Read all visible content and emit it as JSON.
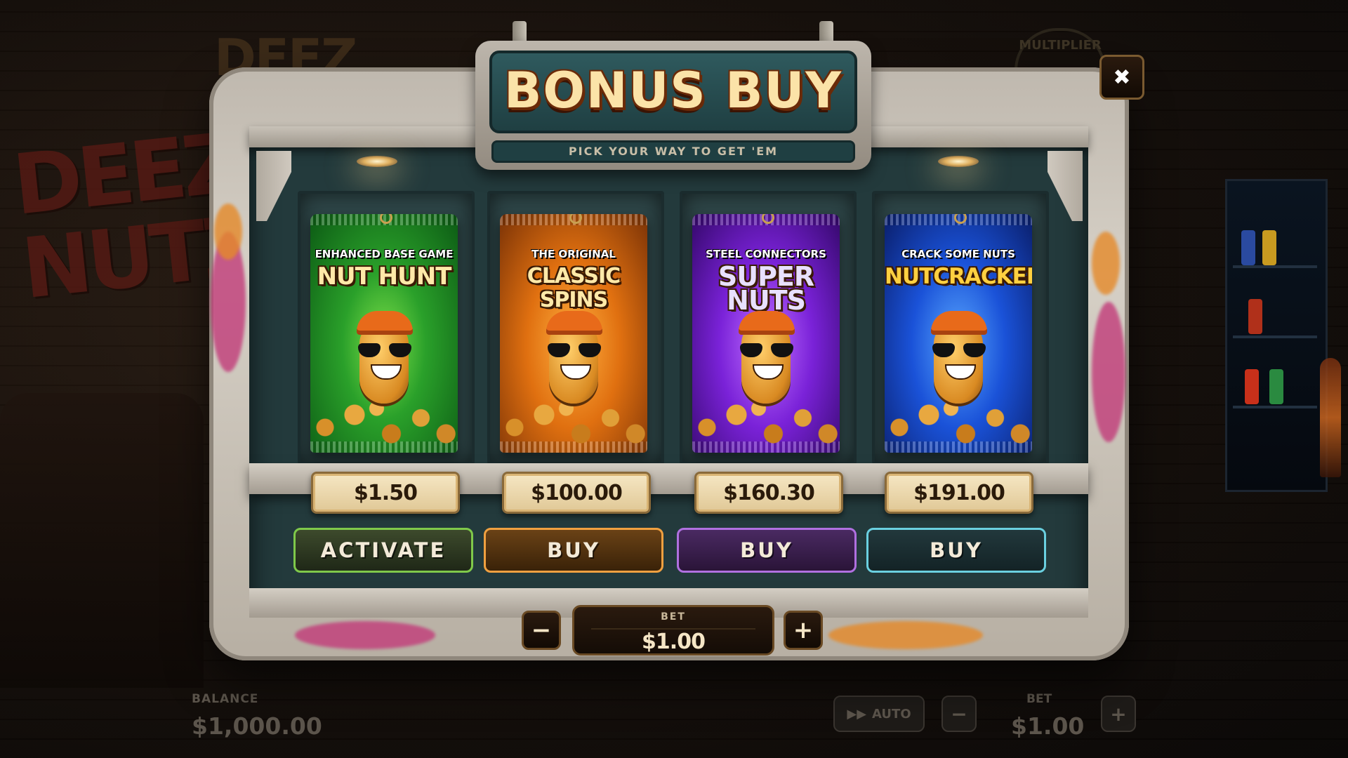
{
  "background": {
    "logo_text": "DEEZ",
    "graffiti_text": "DEEZ NUTZ",
    "multiplier_badge": "MULTIPLIER"
  },
  "hud": {
    "balance_label": "BALANCE",
    "balance_value": "$1,000.00",
    "auto_label": "AUTO",
    "bet_label": "BET",
    "bet_value": "$1.00",
    "minus": "−",
    "plus": "+"
  },
  "header": {
    "title": "BONUS BUY",
    "subtitle": "PICK YOUR WAY TO GET 'EM",
    "close_label": "✖"
  },
  "features": [
    {
      "subtitle": "ENHANCED BASE GAME",
      "title": "NUT HUNT",
      "price": "$1.50",
      "button": "ACTIVATE",
      "color": "#2aa02a"
    },
    {
      "subtitle": "THE ORIGINAL",
      "title": "CLASSIC SPINS",
      "price": "$100.00",
      "button": "BUY",
      "color": "#e07010"
    },
    {
      "subtitle": "STEEL CONNECTORS",
      "title": "SUPER NUTS",
      "price": "$160.30",
      "button": "BUY",
      "color": "#7a22d8"
    },
    {
      "subtitle": "CRACK SOME NUTS",
      "title": "NUTCRACKER",
      "price": "$191.00",
      "button": "BUY",
      "color": "#1a52d8"
    }
  ],
  "bet": {
    "label": "BET",
    "value": "$1.00",
    "decrease": "−",
    "increase": "+"
  }
}
